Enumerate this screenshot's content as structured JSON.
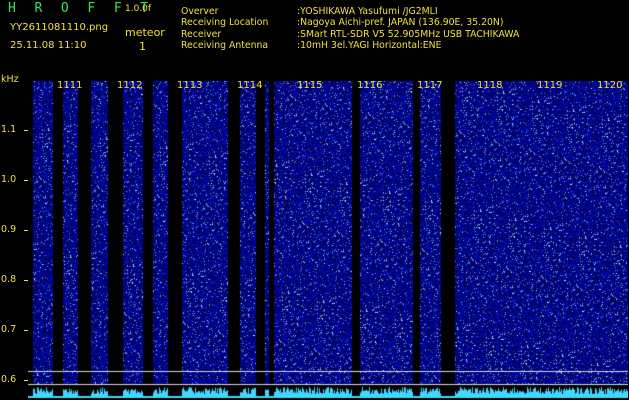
{
  "header": {
    "app_title": "H R O F F T",
    "version": "1.0.0f",
    "file_name": "YY2611081110.png",
    "datetime": "25.11.08 11:10",
    "event_label": "meteor",
    "event_count": "1"
  },
  "station": [
    {
      "key": "Overver",
      "value": ":YOSHIKAWA Yasufumi /JG2MLI"
    },
    {
      "key": "Receiving Location",
      "value": ":Nagoya Aichi-pref. JAPAN (136.90E, 35.20N)"
    },
    {
      "key": "Receiver",
      "value": ":SMart RTL-SDR V5 52.905MHz USB TACHIKAWA"
    },
    {
      "key": "Receiving Antenna",
      "value": ":10mH 3el.YAGI Horizontal:ENE"
    }
  ],
  "axis": {
    "unit": "kHz",
    "freq_labels": [
      "1.1",
      "1.0",
      "0.9",
      "0.8",
      "0.7",
      "0.6"
    ],
    "minute_labels": [
      "1111",
      "1112",
      "1113",
      "1114",
      "1115",
      "1116",
      "1117",
      "1118",
      "1119",
      "1120"
    ]
  },
  "colors": {
    "text": "#f0e040",
    "title": "#37e05a",
    "noise": "#1a1fb0",
    "trace": "#40d8ff"
  }
}
